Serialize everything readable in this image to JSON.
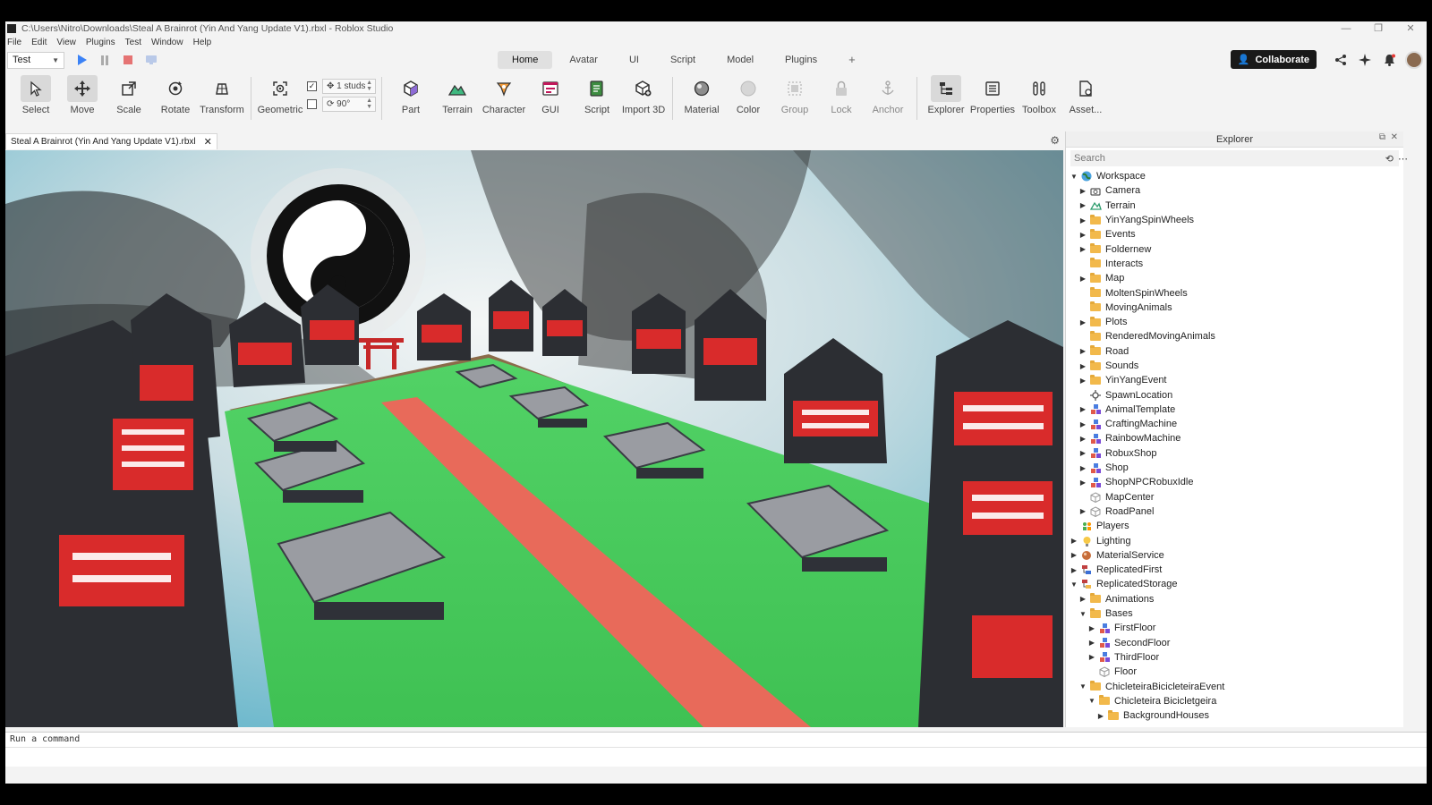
{
  "window": {
    "title": "C:\\Users\\Nitro\\Downloads\\Steal A Brainrot (Yin And Yang Update V1).rbxl - Roblox Studio"
  },
  "menu": [
    "File",
    "Edit",
    "View",
    "Plugins",
    "Test",
    "Window",
    "Help"
  ],
  "topbar": {
    "test_mode": "Test",
    "tabs": [
      "Home",
      "Avatar",
      "UI",
      "Script",
      "Model",
      "Plugins"
    ],
    "active_tab": "Home",
    "collaborate_label": "Collaborate"
  },
  "ribbon": {
    "tools1": [
      "Select",
      "Move",
      "Scale",
      "Rotate",
      "Transform"
    ],
    "geometric_label": "Geometric",
    "move_snap": "1 studs",
    "rotate_snap": "90°",
    "tools2": [
      "Part",
      "Terrain",
      "Character",
      "GUI",
      "Script",
      "Import 3D"
    ],
    "tools3": [
      "Material",
      "Color",
      "Group",
      "Lock",
      "Anchor"
    ],
    "tools4": [
      "Explorer",
      "Properties",
      "Toolbox",
      "Asset..."
    ]
  },
  "document_tab": "Steal A Brainrot (Yin And Yang Update V1).rbxl",
  "explorer": {
    "title": "Explorer",
    "search_placeholder": "Search",
    "nodes": [
      {
        "label": "Workspace",
        "level": 0,
        "arrow": "open",
        "icon": "globe-icon"
      },
      {
        "label": "Camera",
        "level": 1,
        "arrow": "closed",
        "icon": "camera-icon"
      },
      {
        "label": "Terrain",
        "level": 1,
        "arrow": "closed",
        "icon": "terrain-icon"
      },
      {
        "label": "YinYangSpinWheels",
        "level": 1,
        "arrow": "closed",
        "icon": "folder-icon"
      },
      {
        "label": "Events",
        "level": 1,
        "arrow": "closed",
        "icon": "folder-icon"
      },
      {
        "label": "Foldernew",
        "level": 1,
        "arrow": "closed",
        "icon": "folder-icon"
      },
      {
        "label": "Interacts",
        "level": 1,
        "arrow": "none",
        "icon": "folder-icon"
      },
      {
        "label": "Map",
        "level": 1,
        "arrow": "closed",
        "icon": "folder-icon"
      },
      {
        "label": "MoltenSpinWheels",
        "level": 1,
        "arrow": "none",
        "icon": "folder-icon"
      },
      {
        "label": "MovingAnimals",
        "level": 1,
        "arrow": "none",
        "icon": "folder-icon"
      },
      {
        "label": "Plots",
        "level": 1,
        "arrow": "closed",
        "icon": "folder-icon"
      },
      {
        "label": "RenderedMovingAnimals",
        "level": 1,
        "arrow": "none",
        "icon": "folder-icon"
      },
      {
        "label": "Road",
        "level": 1,
        "arrow": "closed",
        "icon": "folder-icon"
      },
      {
        "label": "Sounds",
        "level": 1,
        "arrow": "closed",
        "icon": "folder-icon"
      },
      {
        "label": "YinYangEvent",
        "level": 1,
        "arrow": "closed",
        "icon": "folder-icon"
      },
      {
        "label": "SpawnLocation",
        "level": 1,
        "arrow": "none",
        "icon": "spawn-icon"
      },
      {
        "label": "AnimalTemplate",
        "level": 1,
        "arrow": "closed",
        "icon": "model-icon"
      },
      {
        "label": "CraftingMachine",
        "level": 1,
        "arrow": "closed",
        "icon": "model-icon"
      },
      {
        "label": "RainbowMachine",
        "level": 1,
        "arrow": "closed",
        "icon": "model-icon"
      },
      {
        "label": "RobuxShop",
        "level": 1,
        "arrow": "closed",
        "icon": "model-icon"
      },
      {
        "label": "Shop",
        "level": 1,
        "arrow": "closed",
        "icon": "model-icon"
      },
      {
        "label": "ShopNPCRobuxIdle",
        "level": 1,
        "arrow": "closed",
        "icon": "model-icon"
      },
      {
        "label": "MapCenter",
        "level": 1,
        "arrow": "none",
        "icon": "part-icon"
      },
      {
        "label": "RoadPanel",
        "level": 1,
        "arrow": "closed",
        "icon": "part-icon"
      },
      {
        "label": "Players",
        "level": 0,
        "arrow": "none",
        "icon": "players-icon"
      },
      {
        "label": "Lighting",
        "level": 0,
        "arrow": "closed",
        "icon": "lighting-icon"
      },
      {
        "label": "MaterialService",
        "level": 0,
        "arrow": "closed",
        "icon": "material-service-icon"
      },
      {
        "label": "ReplicatedFirst",
        "level": 0,
        "arrow": "closed",
        "icon": "replicated-first-icon"
      },
      {
        "label": "ReplicatedStorage",
        "level": 0,
        "arrow": "open",
        "icon": "replicated-storage-icon"
      },
      {
        "label": "Animations",
        "level": 1,
        "arrow": "closed",
        "icon": "folder-icon"
      },
      {
        "label": "Bases",
        "level": 1,
        "arrow": "open",
        "icon": "folder-icon"
      },
      {
        "label": "FirstFloor",
        "level": 2,
        "arrow": "closed",
        "icon": "model-icon"
      },
      {
        "label": "SecondFloor",
        "level": 2,
        "arrow": "closed",
        "icon": "model-icon"
      },
      {
        "label": "ThirdFloor",
        "level": 2,
        "arrow": "closed",
        "icon": "model-icon"
      },
      {
        "label": "Floor",
        "level": 2,
        "arrow": "none",
        "icon": "part-icon"
      },
      {
        "label": "ChicleteiraBicicleteiraEvent",
        "level": 1,
        "arrow": "open",
        "icon": "folder-icon"
      },
      {
        "label": "Chicleteira Bicicletgeira",
        "level": 2,
        "arrow": "open",
        "icon": "folder-icon"
      },
      {
        "label": "BackgroundHouses",
        "level": 3,
        "arrow": "closed",
        "icon": "folder-icon"
      }
    ]
  },
  "command_bar": {
    "placeholder": "Run a command"
  },
  "colors": {
    "accent_play": "#3b82f6",
    "stop": "#e57373",
    "collaborate_bg": "#191919",
    "folder": "#f2b94b",
    "grass": "#4cd164",
    "road": "#e86a5a",
    "roof_red": "#d92b2b",
    "pagoda_dark": "#2c2e33"
  }
}
